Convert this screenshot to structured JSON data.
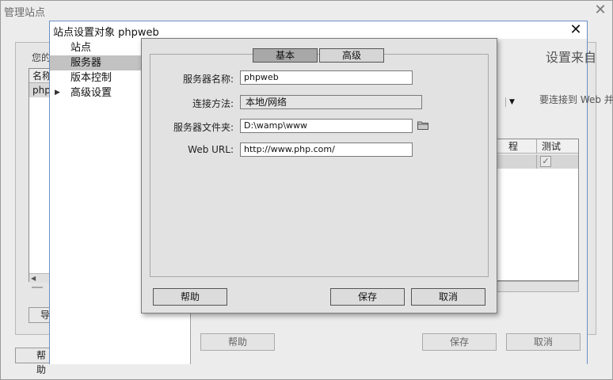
{
  "outer": {
    "title": "管理站点",
    "description_fragment": "您的",
    "list_header": "名称",
    "list_row": "php",
    "import_label": "导",
    "help_label": "帮助"
  },
  "site_dialog": {
    "title": "站点设置对象 phpweb",
    "nav": [
      {
        "label": "站点",
        "selected": false
      },
      {
        "label": "服务器",
        "selected": true
      },
      {
        "label": "版本控制",
        "selected": false
      },
      {
        "label": "高级设置",
        "selected": false,
        "expandable": true
      }
    ],
    "heading_fragment": "设置来自",
    "note_fragment": "要连接到 Web 并发",
    "table_columns": [
      "程",
      "测试"
    ],
    "row_test_checked": true,
    "help_label": "帮助",
    "save_label": "保存",
    "cancel_label": "取消"
  },
  "server_dialog": {
    "tabs": [
      {
        "label": "基本",
        "active": true
      },
      {
        "label": "高级",
        "active": false
      }
    ],
    "fields": {
      "server_name": {
        "label": "服务器名称:",
        "value": "phpweb"
      },
      "connect_method": {
        "label": "连接方法:",
        "value": "本地/网络"
      },
      "server_folder": {
        "label": "服务器文件夹:",
        "value": "D:\\wamp\\www"
      },
      "web_url": {
        "label": "Web URL:",
        "value": "http://www.php.com/"
      }
    },
    "help_label": "帮助",
    "save_label": "保存",
    "cancel_label": "取消"
  },
  "colors": {
    "dialog_border": "#6a8fc4",
    "selected_nav": "#c2c2c2",
    "active_tab": "#a8a8a8"
  }
}
